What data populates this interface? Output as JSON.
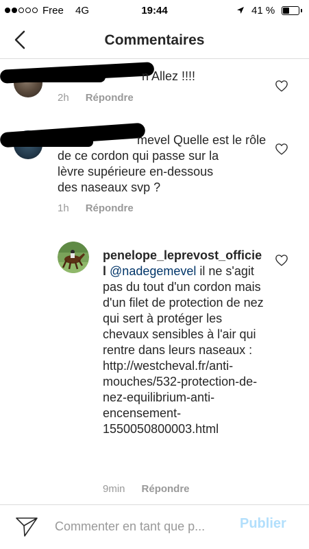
{
  "status_bar": {
    "carrier": "Free",
    "network": "4G",
    "time": "19:44",
    "battery_percent": "41 %",
    "battery_level": 0.41,
    "signal_bars_filled": 2,
    "signal_bars_total": 5
  },
  "header": {
    "title": "Commentaires",
    "back_icon": "chevron-left-icon"
  },
  "comments": [
    {
      "text": "n Allez !!!!",
      "time": "2h",
      "reply_label": "Répondre"
    },
    {
      "text_line1": "mevel Quelle est le rôle",
      "text_line2": "de ce cordon qui passe sur la",
      "text_line3": "lèvre supérieure en-dessous",
      "text_line4": "des naseaux svp ?",
      "time": "1h",
      "reply_label": "Répondre"
    }
  ],
  "reply": {
    "username": "penelope_leprevost_officiel",
    "mention": "@nadegemevel",
    "text": " il ne s'agit pas du tout d'un cordon mais d'un filet de protection de nez qui sert à protéger les chevaux sensibles à l'air qui rentre dans leurs naseaux : http://westcheval.fr/anti-mouches/532-protection-de-nez-equilibrium-anti-encensement-1550050800003.html",
    "time": "9min",
    "reply_label": "Répondre"
  },
  "footer": {
    "input_placeholder": "Commenter en tant que p...",
    "publish_label": "Publier",
    "send_icon": "paper-plane-icon"
  },
  "colors": {
    "text": "#262626",
    "muted": "#999999",
    "mention": "#003569",
    "publish_disabled": "#b2dffc",
    "divider": "#dbdbdb"
  }
}
